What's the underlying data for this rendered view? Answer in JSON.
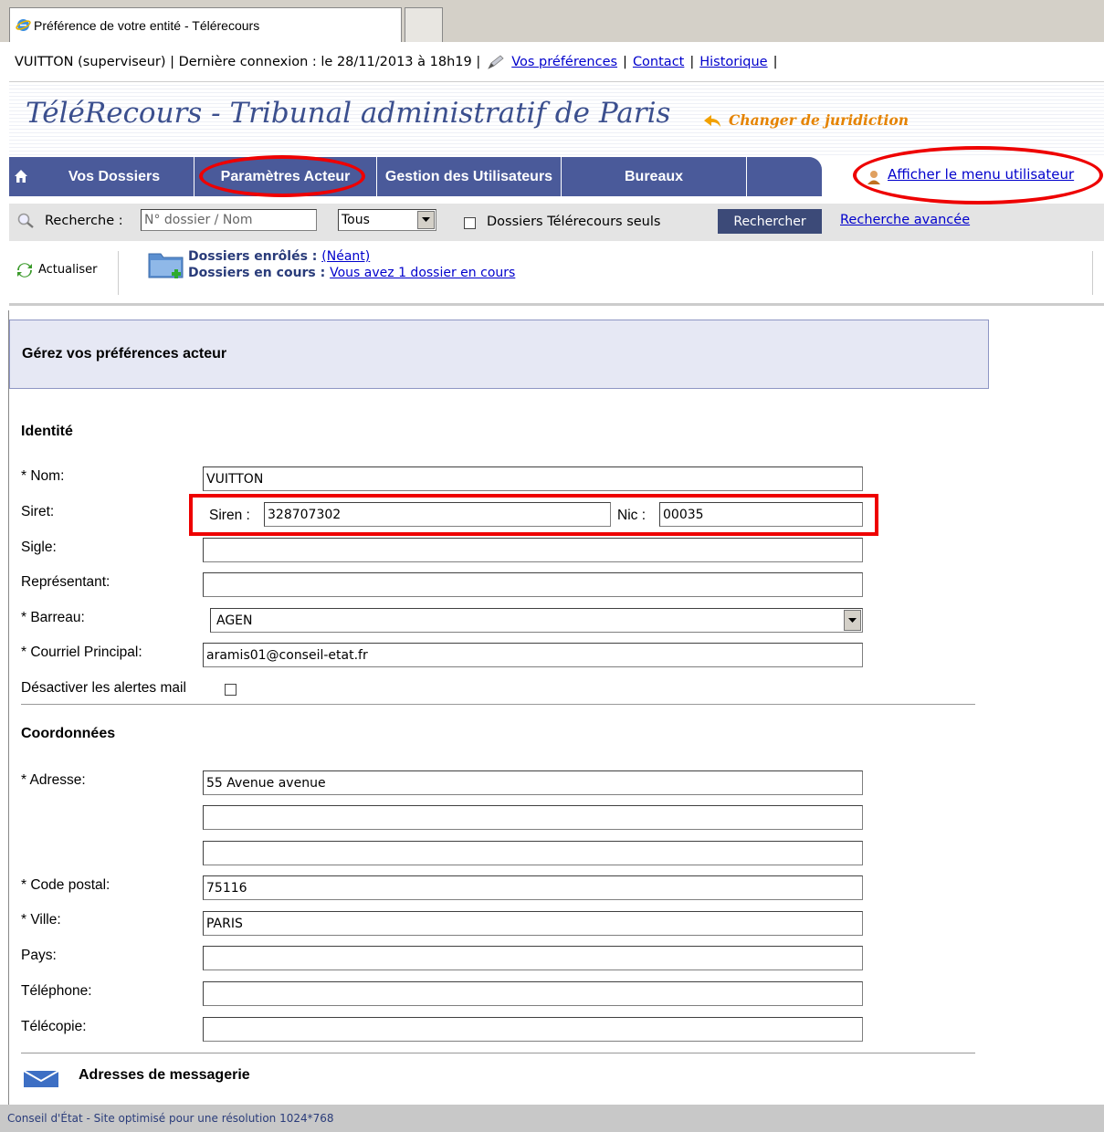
{
  "browser": {
    "tab_title": "Préférence de votre entité - Télérecours"
  },
  "userbar": {
    "user_info": "VUITTON (superviseur) | Dernière connexion : le 28/11/2013 à 18h19 |",
    "prefs": "Vos préférences",
    "sep1": "|",
    "contact": "Contact",
    "sep2": "|",
    "history": "Historique",
    "sep3": "|"
  },
  "header": {
    "title": "TéléRecours - Tribunal administratif de Paris",
    "change": "Changer de juridiction"
  },
  "nav": {
    "items": [
      "Vos Dossiers",
      "Paramètres Acteur",
      "Gestion des Utilisateurs",
      "Bureaux"
    ],
    "user_menu": "Afficher le menu utilisateur"
  },
  "search": {
    "label": "Recherche :",
    "placeholder": "N° dossier / Nom",
    "select_value": "Tous",
    "checkbox_label": "Dossiers Télérecours seuls",
    "button": "Rechercher",
    "advanced": "Recherche avancée"
  },
  "toolbar": {
    "refresh": "Actualiser",
    "enrolled_label": "Dossiers enrôlés :",
    "enrolled_value": "(Néant)",
    "current_label": "Dossiers en cours :",
    "current_value": "Vous avez 1 dossier en cours"
  },
  "page": {
    "heading": "Gérez vos préférences acteur"
  },
  "identite": {
    "title": "Identité",
    "nom_label": "* Nom:",
    "nom_value": "VUITTON",
    "siret_label": "Siret:",
    "siren_label": "Siren :",
    "siren_value": "328707302",
    "nic_label": "Nic :",
    "nic_value": "00035",
    "sigle_label": "Sigle:",
    "sigle_value": "",
    "rep_label": "Représentant:",
    "rep_value": "",
    "barreau_label": "* Barreau:",
    "barreau_value": "AGEN",
    "email_label": "* Courriel Principal:",
    "email_value": "aramis01@conseil-etat.fr",
    "alerts_label": "Désactiver les alertes mail"
  },
  "coordonnees": {
    "title": "Coordonnées",
    "adresse_label": "* Adresse:",
    "adresse1": "55 Avenue avenue",
    "adresse2": "",
    "adresse3": "",
    "cp_label": "* Code postal:",
    "cp_value": "75116",
    "ville_label": "* Ville:",
    "ville_value": "PARIS",
    "pays_label": "Pays:",
    "pays_value": "",
    "tel_label": "Téléphone:",
    "tel_value": "",
    "fax_label": "Télécopie:",
    "fax_value": ""
  },
  "messagerie": {
    "title": "Adresses de messagerie"
  },
  "footer": {
    "text": "Conseil d'État - Site optimisé pour une résolution 1024*768"
  },
  "colors": {
    "nav": "#4a5a9a",
    "title": "#3b4f8e",
    "annotation": "#ee0000",
    "accent": "#e58300"
  }
}
